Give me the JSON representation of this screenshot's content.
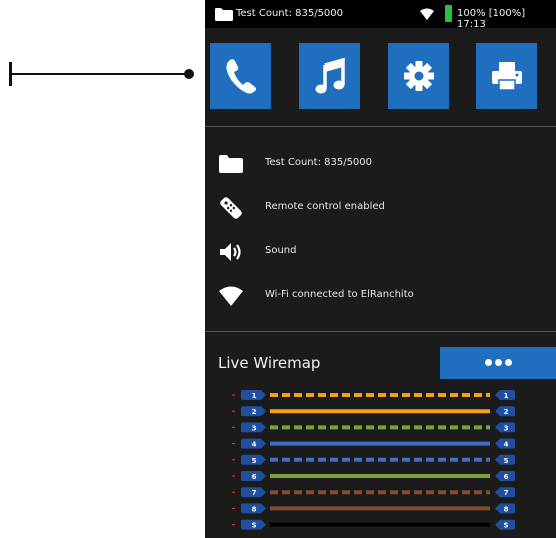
{
  "status_bar": {
    "test_count": "Test Count: 835/5000",
    "battery_text": "100% [100%] 17:13"
  },
  "tiles": [
    {
      "icon": "phone-icon"
    },
    {
      "icon": "music-icon"
    },
    {
      "icon": "gear-icon"
    },
    {
      "icon": "printer-icon"
    }
  ],
  "info": {
    "test_count": "Test Count: 835/5000",
    "remote": "Remote control enabled",
    "sound": "Sound",
    "wifi": "Wi-Fi connected to ElRanchito"
  },
  "wiremap": {
    "title": "Live Wiremap",
    "pins_left": [
      "1",
      "2",
      "3",
      "4",
      "5",
      "6",
      "7",
      "8",
      "S"
    ],
    "pins_right": [
      "1",
      "2",
      "3",
      "4",
      "5",
      "6",
      "7",
      "8",
      "S"
    ],
    "wires": [
      {
        "color": "#f5a21b",
        "style": "dashed"
      },
      {
        "color": "#f5a21b",
        "style": "solid"
      },
      {
        "color": "#7fa33a",
        "style": "dashed"
      },
      {
        "color": "#3e6fc4",
        "style": "solid"
      },
      {
        "color": "#3e6fc4",
        "style": "dashed"
      },
      {
        "color": "#7fa33a",
        "style": "solid"
      },
      {
        "color": "#8a4a32",
        "style": "dashed"
      },
      {
        "color": "#8a4a32",
        "style": "solid"
      },
      {
        "color": "#000000",
        "style": "solid"
      }
    ]
  },
  "colors": {
    "accent": "#1f6fbe",
    "background": "#1b1b1b",
    "battery": "#27c03a"
  }
}
